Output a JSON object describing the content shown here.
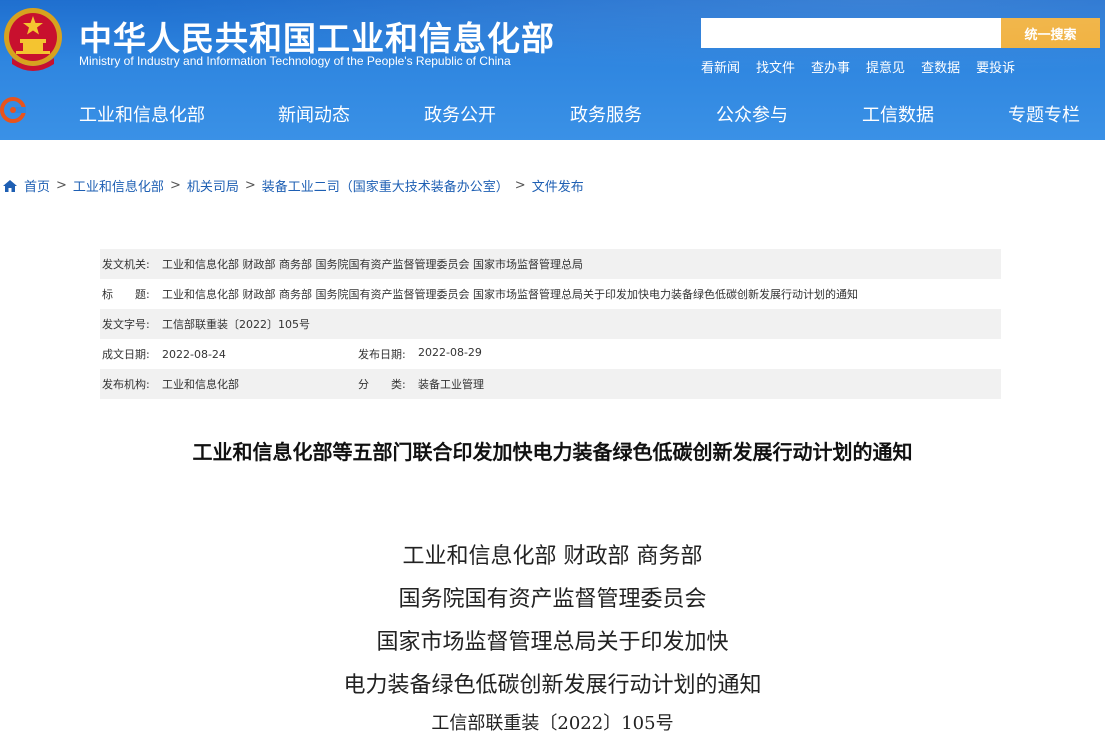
{
  "header": {
    "title": "中华人民共和国工业和信息化部",
    "subtitle": "Ministry of Industry and Information Technology of the People's Republic of China",
    "search": {
      "placeholder": "",
      "button_label": "统一搜索"
    },
    "quick_links": [
      "看新闻",
      "找文件",
      "查办事",
      "提意见",
      "查数据",
      "要投诉"
    ],
    "nav": [
      "工业和信息化部",
      "新闻动态",
      "政务公开",
      "政务服务",
      "公众参与",
      "工信数据",
      "专题专栏"
    ]
  },
  "breadcrumb": [
    "首页",
    "工业和信息化部",
    "机关司局",
    "装备工业二司（国家重大技术装备办公室）",
    "文件发布"
  ],
  "meta": {
    "issuer_label": "发文机关:",
    "issuer": "工业和信息化部 财政部 商务部 国务院国有资产监督管理委员会 国家市场监督管理总局",
    "title_label": "标　　题:",
    "title": "工业和信息化部 财政部 商务部 国务院国有资产监督管理委员会 国家市场监督管理总局关于印发加快电力装备绿色低碳创新发展行动计划的通知",
    "doc_no_label": "发文字号:",
    "doc_no": "工信部联重装〔2022〕105号",
    "created_label": "成文日期:",
    "created": "2022-08-24",
    "published_label": "发布日期:",
    "published": "2022-08-29",
    "org_label": "发布机构:",
    "org": "工业和信息化部",
    "category_label": "分　　类:",
    "category": "装备工业管理"
  },
  "article": {
    "title": "工业和信息化部等五部门联合印发加快电力装备绿色低碳创新发展行动计划的通知",
    "lines": [
      "工业和信息化部 财政部 商务部",
      "国务院国有资产监督管理委员会",
      "国家市场监督管理总局关于印发加快",
      "电力装备绿色低碳创新发展行动计划的通知"
    ],
    "doc_number": "工信部联重装〔2022〕105号"
  },
  "colors": {
    "header_blue": "#2f86e0",
    "search_button": "#f0b03c",
    "link_blue": "#1e5fb3",
    "row_alt": "#f1f1f1"
  },
  "icons": [
    "national-emblem-icon",
    "nav-logo-icon",
    "home-icon"
  ]
}
